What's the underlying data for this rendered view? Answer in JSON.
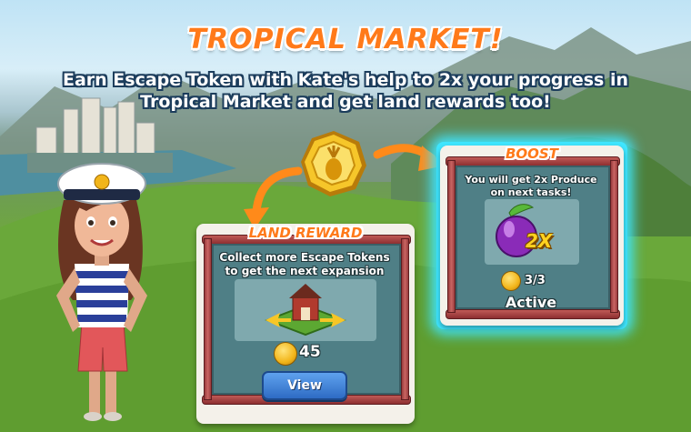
{
  "header": {
    "title": "TROPICAL MARKET!",
    "subtitle_line1": "Earn Escape Token with Kate's help to 2x your progress in",
    "subtitle_line2": "Tropical Market and get land rewards too!"
  },
  "land_reward": {
    "ribbon": "LAND REWARD",
    "description_line1": "Collect more Escape Tokens",
    "description_line2": "to get the next expansion",
    "cost": "45",
    "button_label": "View"
  },
  "boost": {
    "ribbon": "BOOST",
    "description_line1": "You will get 2x Produce",
    "description_line2": "on next tasks!",
    "multiplier": "2X",
    "progress": "3/3",
    "status": "Active"
  },
  "icons": {
    "token": "pineapple-coin-icon",
    "fruit": "plum-icon",
    "barn": "barn-icon"
  },
  "colors": {
    "title_orange": "#ff7a1a",
    "panel_teal": "#4f7f86",
    "boost_glow": "#3fe6ff",
    "button_blue": "#2e6bc4"
  }
}
